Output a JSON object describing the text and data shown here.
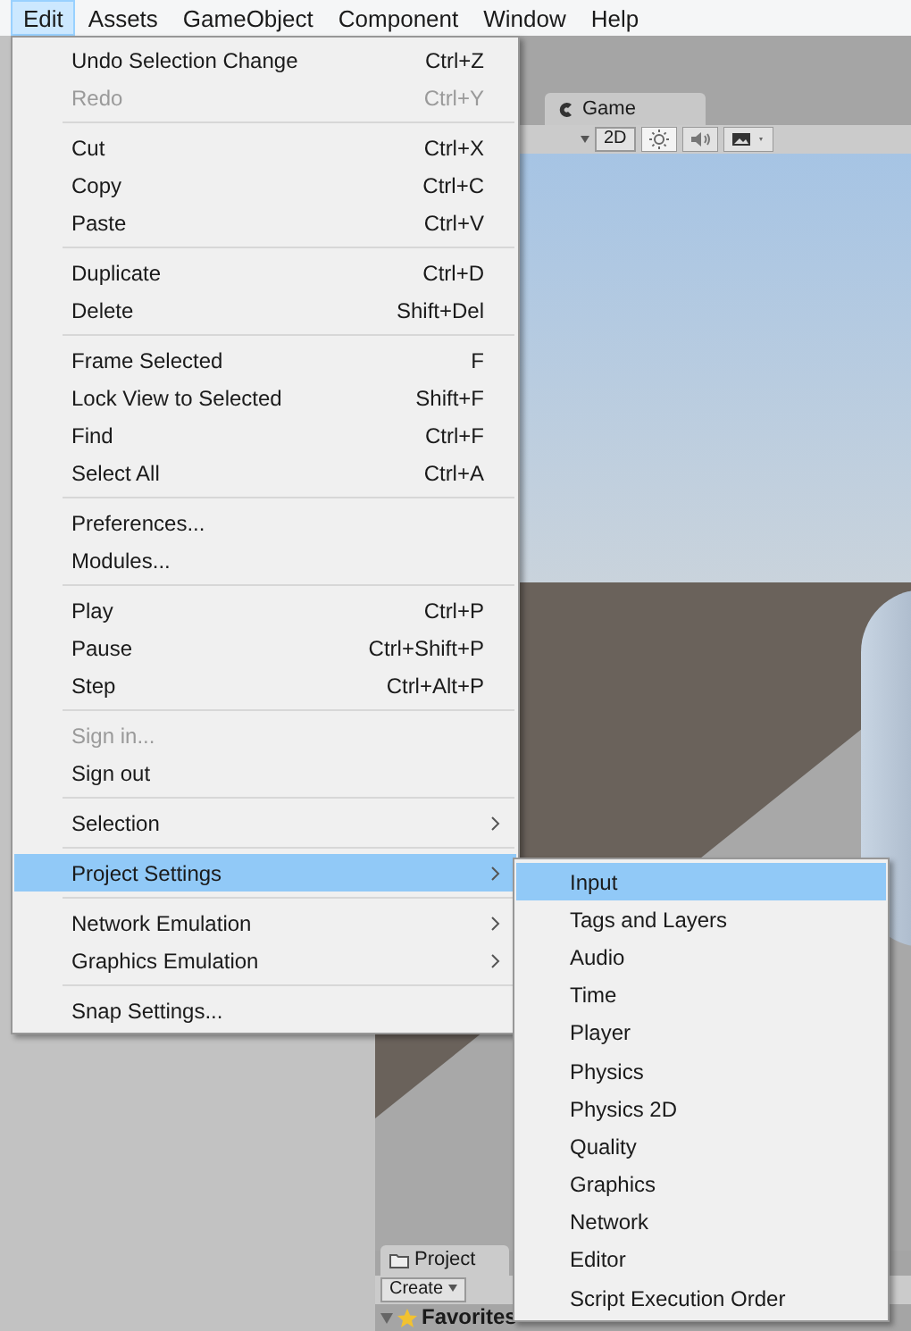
{
  "menu_bar": [
    {
      "label": "Edit",
      "selected": true
    },
    {
      "label": "Assets",
      "selected": false
    },
    {
      "label": "GameObject",
      "selected": false
    },
    {
      "label": "Component",
      "selected": false
    },
    {
      "label": "Window",
      "selected": false
    },
    {
      "label": "Help",
      "selected": false
    }
  ],
  "scene": {
    "game_tab": "Game",
    "toolbar_2d": "2D"
  },
  "project_panel": {
    "tab": "Project",
    "create": "Create",
    "favorites": "Favorites"
  },
  "edit_menu": [
    [
      {
        "kind": "command",
        "label": "Undo Selection Change",
        "shortcut": "Ctrl+Z",
        "disabled": false,
        "selected": false
      },
      {
        "kind": "command",
        "label": "Redo",
        "shortcut": "Ctrl+Y",
        "disabled": true,
        "selected": false
      }
    ],
    [
      {
        "kind": "command",
        "label": "Cut",
        "shortcut": "Ctrl+X",
        "disabled": false,
        "selected": false
      },
      {
        "kind": "command",
        "label": "Copy",
        "shortcut": "Ctrl+C",
        "disabled": false,
        "selected": false
      },
      {
        "kind": "command",
        "label": "Paste",
        "shortcut": "Ctrl+V",
        "disabled": false,
        "selected": false
      }
    ],
    [
      {
        "kind": "command",
        "label": "Duplicate",
        "shortcut": "Ctrl+D",
        "disabled": false,
        "selected": false
      },
      {
        "kind": "command",
        "label": "Delete",
        "shortcut": "Shift+Del",
        "disabled": false,
        "selected": false
      }
    ],
    [
      {
        "kind": "command",
        "label": "Frame Selected",
        "shortcut": "F",
        "disabled": false,
        "selected": false
      },
      {
        "kind": "command",
        "label": "Lock View to Selected",
        "shortcut": "Shift+F",
        "disabled": false,
        "selected": false
      },
      {
        "kind": "command",
        "label": "Find",
        "shortcut": "Ctrl+F",
        "disabled": false,
        "selected": false
      },
      {
        "kind": "command",
        "label": "Select All",
        "shortcut": "Ctrl+A",
        "disabled": false,
        "selected": false
      }
    ],
    [
      {
        "kind": "command",
        "label": "Preferences...",
        "disabled": false,
        "selected": false
      },
      {
        "kind": "command",
        "label": "Modules...",
        "disabled": false,
        "selected": false
      }
    ],
    [
      {
        "kind": "command",
        "label": "Play",
        "shortcut": "Ctrl+P",
        "disabled": false,
        "selected": false
      },
      {
        "kind": "command",
        "label": "Pause",
        "shortcut": "Ctrl+Shift+P",
        "disabled": false,
        "selected": false
      },
      {
        "kind": "command",
        "label": "Step",
        "shortcut": "Ctrl+Alt+P",
        "disabled": false,
        "selected": false
      }
    ],
    [
      {
        "kind": "command",
        "label": "Sign in...",
        "disabled": true,
        "selected": false
      },
      {
        "kind": "command",
        "label": "Sign out",
        "disabled": false,
        "selected": false
      }
    ],
    [
      {
        "kind": "submenu",
        "label": "Selection",
        "disabled": false,
        "selected": false
      }
    ],
    [
      {
        "kind": "submenu",
        "label": "Project Settings",
        "disabled": false,
        "selected": true
      }
    ],
    [
      {
        "kind": "submenu",
        "label": "Network Emulation",
        "disabled": false,
        "selected": false
      },
      {
        "kind": "submenu",
        "label": "Graphics Emulation",
        "disabled": false,
        "selected": false
      }
    ],
    [
      {
        "kind": "command",
        "label": "Snap Settings...",
        "disabled": false,
        "selected": false
      }
    ]
  ],
  "project_settings_submenu": [
    {
      "label": "Input",
      "selected": true
    },
    {
      "label": "Tags and Layers",
      "selected": false
    },
    {
      "label": "Audio",
      "selected": false
    },
    {
      "label": "Time",
      "selected": false
    },
    {
      "label": "Player",
      "selected": false
    },
    {
      "label": "Physics",
      "selected": false
    },
    {
      "label": "Physics 2D",
      "selected": false
    },
    {
      "label": "Quality",
      "selected": false
    },
    {
      "label": "Graphics",
      "selected": false
    },
    {
      "label": "Network",
      "selected": false
    },
    {
      "label": "Editor",
      "selected": false
    },
    {
      "label": "Script Execution Order",
      "selected": false
    }
  ]
}
